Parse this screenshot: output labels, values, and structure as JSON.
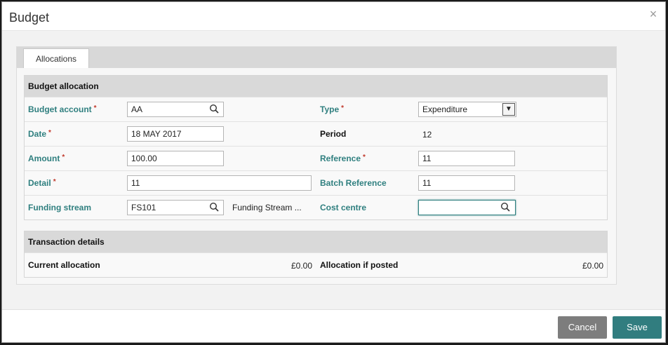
{
  "dialog": {
    "title": "Budget",
    "close_label": "×"
  },
  "tabs": [
    {
      "label": "Allocations"
    }
  ],
  "budget_allocation": {
    "header": "Budget allocation",
    "budget_account": {
      "label": "Budget account",
      "required": "*",
      "value": "AA"
    },
    "type": {
      "label": "Type",
      "required": "*",
      "value": "Expenditure"
    },
    "date": {
      "label": "Date",
      "required": "*",
      "value": "18 MAY 2017"
    },
    "period": {
      "label": "Period",
      "value": "12"
    },
    "amount": {
      "label": "Amount",
      "required": "*",
      "value": "100.00"
    },
    "reference": {
      "label": "Reference",
      "required": "*",
      "value": "11"
    },
    "detail": {
      "label": "Detail",
      "required": "*",
      "value": "11"
    },
    "batch_reference": {
      "label": "Batch Reference",
      "value": "11"
    },
    "funding_stream": {
      "label": "Funding stream",
      "value": "FS101",
      "description": "Funding Stream ..."
    },
    "cost_centre": {
      "label": "Cost centre",
      "value": ""
    }
  },
  "transaction_details": {
    "header": "Transaction details",
    "current_allocation": {
      "label": "Current allocation",
      "value": "£0.00"
    },
    "allocation_if_posted": {
      "label": "Allocation if posted",
      "value": "£0.00"
    }
  },
  "footer": {
    "cancel_label": "Cancel",
    "save_label": "Save"
  },
  "colors": {
    "accent": "#317d7f",
    "label": "#2f7f7f",
    "required": "#c0392b",
    "cancel": "#7d7d7d"
  }
}
